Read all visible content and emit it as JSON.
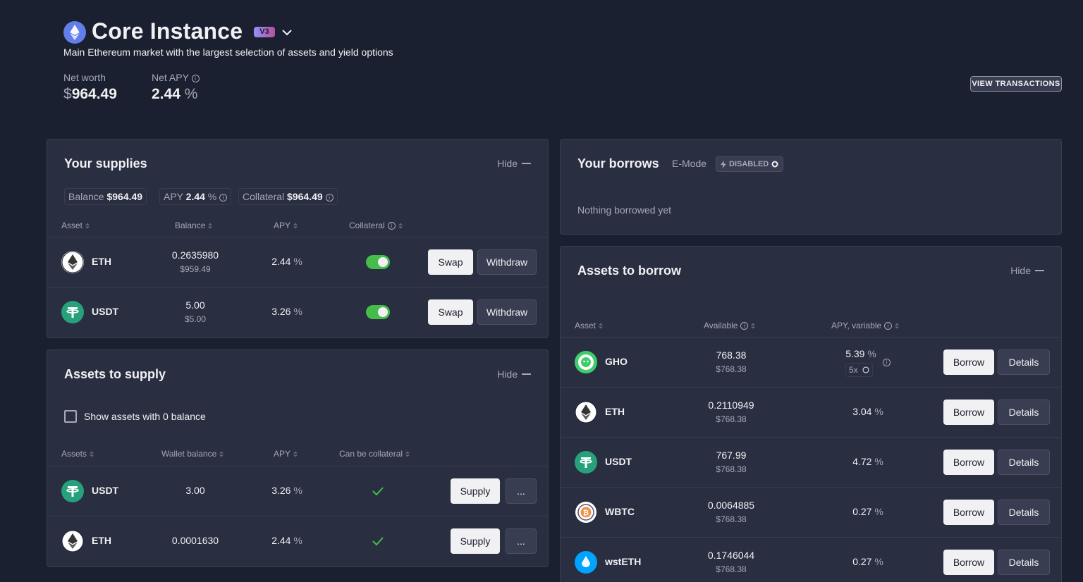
{
  "header": {
    "title": "Core Instance",
    "version_badge": "V3",
    "description": "Main Ethereum market with the largest selection of assets and yield options",
    "net_worth_label": "Net worth",
    "net_worth_symbol": "$",
    "net_worth_value": "964.49",
    "net_apy_label": "Net APY",
    "net_apy_value": "2.44",
    "net_apy_unit": "%",
    "view_transactions": "VIEW TRANSACTIONS"
  },
  "supplies": {
    "title": "Your supplies",
    "hide": "Hide",
    "balance_label": "Balance",
    "balance_value": "$964.49",
    "apy_label": "APY",
    "apy_value": "2.44",
    "collateral_label": "Collateral",
    "collateral_value": "$964.49",
    "columns": [
      "Asset",
      "Balance",
      "APY",
      "Collateral"
    ],
    "rows": [
      {
        "asset": "ETH",
        "balance": "0.2635980",
        "usd": "$959.49",
        "apy": "2.44",
        "swap": "Swap",
        "withdraw": "Withdraw"
      },
      {
        "asset": "USDT",
        "balance": "5.00",
        "usd": "$5.00",
        "apy": "3.26",
        "swap": "Swap",
        "withdraw": "Withdraw"
      }
    ]
  },
  "to_supply": {
    "title": "Assets to supply",
    "hide": "Hide",
    "show_zero": "Show assets with 0 balance",
    "columns": [
      "Assets",
      "Wallet balance",
      "APY",
      "Can be collateral"
    ],
    "rows": [
      {
        "asset": "USDT",
        "balance": "3.00",
        "apy": "3.26",
        "supply": "Supply",
        "more": "..."
      },
      {
        "asset": "ETH",
        "balance": "0.0001630",
        "apy": "2.44",
        "supply": "Supply",
        "more": "..."
      }
    ]
  },
  "borrows": {
    "title": "Your borrows",
    "emode_label": "E-Mode",
    "emode_status": "DISABLED",
    "empty": "Nothing borrowed yet"
  },
  "to_borrow": {
    "title": "Assets to borrow",
    "hide": "Hide",
    "columns": [
      "Asset",
      "Available",
      "APY, variable"
    ],
    "rows": [
      {
        "asset": "GHO",
        "available": "768.38",
        "usd": "$768.38",
        "apy": "5.39",
        "multiplier": "5x",
        "borrow": "Borrow",
        "details": "Details"
      },
      {
        "asset": "ETH",
        "available": "0.2110949",
        "usd": "$768.38",
        "apy": "3.04",
        "borrow": "Borrow",
        "details": "Details"
      },
      {
        "asset": "USDT",
        "available": "767.99",
        "usd": "$768.38",
        "apy": "4.72",
        "borrow": "Borrow",
        "details": "Details"
      },
      {
        "asset": "WBTC",
        "available": "0.0064885",
        "usd": "$768.38",
        "apy": "0.27",
        "borrow": "Borrow",
        "details": "Details"
      },
      {
        "asset": "wstETH",
        "available": "0.1746044",
        "usd": "$768.38",
        "apy": "0.27",
        "borrow": "Borrow",
        "details": "Details"
      }
    ]
  },
  "percent_unit": "%",
  "colors": {
    "background": "#1b2030",
    "panel": "#292e41",
    "toggle_on": "#46bc4b",
    "check": "#46bc4b"
  }
}
